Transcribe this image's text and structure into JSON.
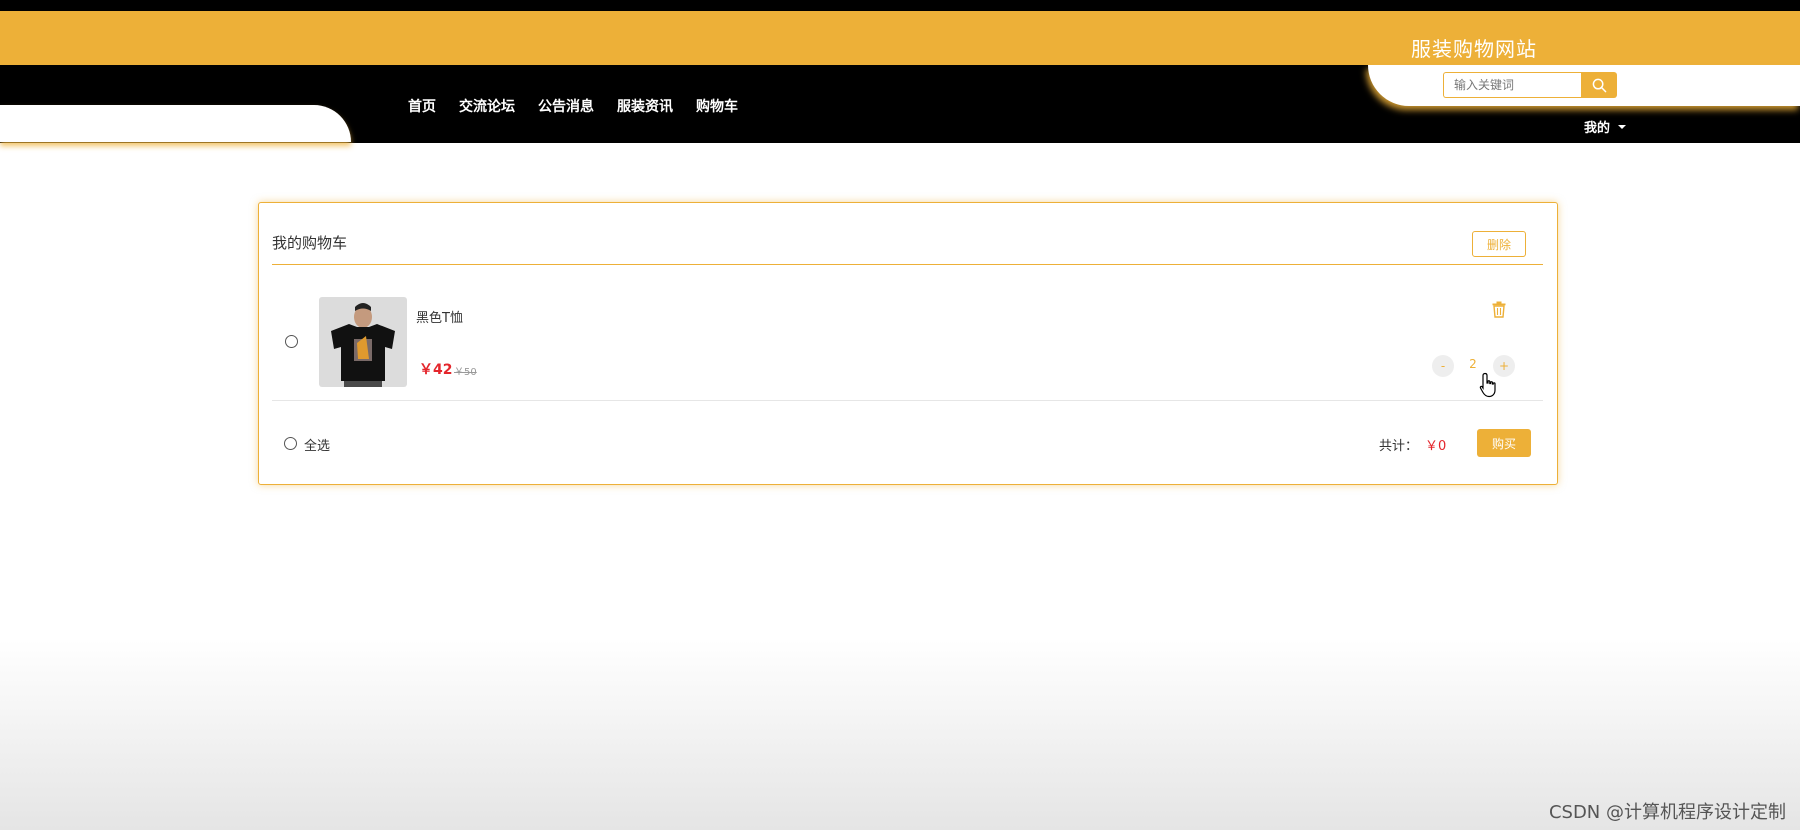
{
  "header": {
    "site_title": "服装购物网站",
    "search_placeholder": "输入关键词",
    "mine_label": "我的"
  },
  "nav": {
    "items": [
      "首页",
      "交流论坛",
      "公告消息",
      "服装资讯",
      "购物车"
    ]
  },
  "cart": {
    "title": "我的购物车",
    "delete_label": "删除",
    "items": [
      {
        "name": "黑色T恤",
        "price": "￥42",
        "original_price": "￥50",
        "quantity": "2",
        "minus_label": "-",
        "plus_label": "+"
      }
    ],
    "select_all_label": "全选",
    "total_label": "共计：",
    "total_value": "￥0",
    "buy_label": "购买"
  },
  "watermark": "CSDN @计算机程序设计定制",
  "colors": {
    "accent": "#EDB038",
    "price_red": "#E4262C",
    "navbar": "#000000"
  },
  "icons": [
    "search-icon",
    "caret-down-icon",
    "trash-icon",
    "hand-pointer-cursor"
  ]
}
